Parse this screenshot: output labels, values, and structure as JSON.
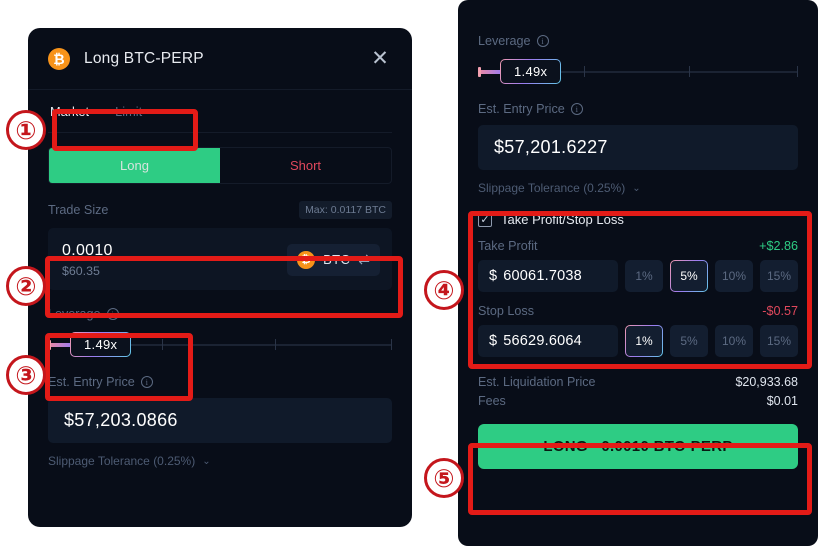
{
  "left_panel": {
    "header": {
      "coin_symbol": "₿",
      "title": "Long BTC-PERP",
      "close_label": "✕"
    },
    "order_tabs": [
      {
        "label": "Market",
        "active": true
      },
      {
        "label": "Limit",
        "active": false
      }
    ],
    "side_buttons": {
      "long_label": "Long",
      "short_label": "Short"
    },
    "trade_size": {
      "label": "Trade Size",
      "max_badge": "Max: 0.0117 BTC",
      "amount": "0.0010",
      "usd_value": "$60.35",
      "token_symbol": "BTC",
      "token_coin_symbol": "₿",
      "swap_icon": "⇄"
    },
    "leverage": {
      "label": "Leverage",
      "info_icon": "i",
      "value": "1.49x"
    },
    "entry_price": {
      "label": "Est. Entry Price",
      "info_icon": "i",
      "value": "$57,203.0866"
    },
    "slippage": {
      "label": "Slippage Tolerance (0.25%)",
      "chevron": "⌄"
    }
  },
  "right_panel": {
    "leverage": {
      "label": "Leverage",
      "info_icon": "i",
      "value": "1.49x"
    },
    "entry_price": {
      "label": "Est. Entry Price",
      "info_icon": "i",
      "value": "$57,201.6227"
    },
    "slippage": {
      "label": "Slippage Tolerance (0.25%)",
      "chevron": "⌄"
    },
    "tpsl": {
      "checkbox_label": "Take Profit/Stop Loss",
      "checkbox_mark": "✓",
      "take_profit": {
        "name": "Take Profit",
        "delta": "+$2.86",
        "currency": "$",
        "value": "60061.7038",
        "percents": [
          {
            "label": "1%",
            "active": false
          },
          {
            "label": "5%",
            "active": true
          },
          {
            "label": "10%",
            "active": false
          },
          {
            "label": "15%",
            "active": false
          }
        ]
      },
      "stop_loss": {
        "name": "Stop Loss",
        "delta": "-$0.57",
        "currency": "$",
        "value": "56629.6064",
        "percents": [
          {
            "label": "1%",
            "active": true
          },
          {
            "label": "5%",
            "active": false
          },
          {
            "label": "10%",
            "active": false
          },
          {
            "label": "15%",
            "active": false
          }
        ]
      }
    },
    "summary": [
      {
        "key": "Est. Liquidation Price",
        "value": "$20,933.68"
      },
      {
        "key": "Fees",
        "value": "$0.01"
      }
    ],
    "cta_label": "LONG ~0.0010 BTC-PERP"
  },
  "annotations": {
    "numbers": [
      "①",
      "②",
      "③",
      "④",
      "⑤"
    ],
    "accent_color": "#e31b17"
  },
  "colors": {
    "panel_bg": "#080d18",
    "long_green": "#2ecc84",
    "short_red": "#e0485c",
    "bitcoin_orange": "#f7931a",
    "annotation_red": "#e31b17"
  }
}
